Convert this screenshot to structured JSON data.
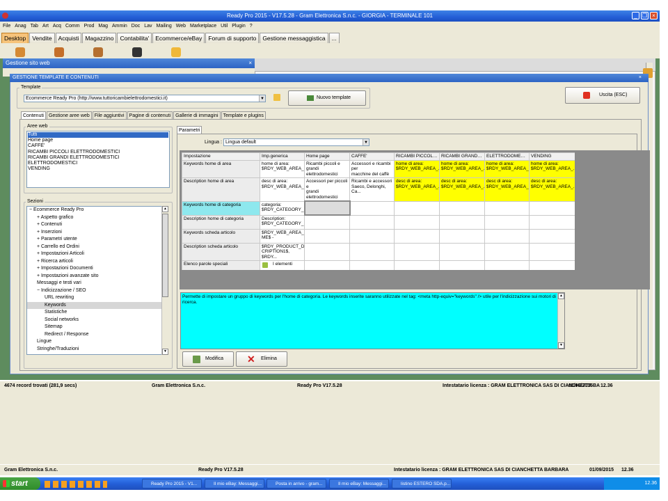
{
  "window": {
    "title": "Ready Pro 2015 - V17.5.28 - Gram Elettronica S.n.c. - GIORGIA - TERMINALE 101"
  },
  "menubar": [
    "File",
    "Anag",
    "Tab",
    "Art",
    "Acq",
    "Comm",
    "Prod",
    "Mag",
    "Ammin",
    "Doc",
    "Lav",
    "Mailing",
    "Web",
    "Marketplace",
    "Util",
    "Plugin",
    "?"
  ],
  "tabs": [
    "Desktop",
    "Vendite",
    "Acquisti",
    "Magazzino",
    "Contabilita'",
    "Ecommerce/eBay",
    "Forum di supporto",
    "Gestione messaggistica",
    "..."
  ],
  "subwindow": {
    "title": "Gestione sito web"
  },
  "main_window": {
    "title": "GESTIONE TEMPLATE E CONTENUTI",
    "template_label": "Template",
    "template_value": "Ecommerce Ready Pro (http://www.tuttoricambielettrodomestici.it)",
    "nuovo_template": "Nuovo template",
    "uscita": "Uscita (ESC)",
    "tabs": [
      "Contenuti",
      "Gestione aree web",
      "File aggiuntivi",
      "Pagine di contenuti",
      "Gallerie di immagini",
      "Template e plugins"
    ],
    "aree_web_label": "Aree web",
    "aree_web": [
      "Tutti",
      "Home page",
      "CAFFE'",
      "RICAMBI PICCOLI ELETTRODOMESTICI",
      "RICAMBI GRANDI ELETTRODOMESTICI",
      "ELETTRODOMESTICI",
      "VENDING"
    ],
    "sezioni_label": "Sezioni",
    "sezioni": [
      {
        "text": "− Ecommerce Ready Pro",
        "level": 0
      },
      {
        "text": "+ Aspetto grafico",
        "level": 1
      },
      {
        "text": "+ Contenuti",
        "level": 1
      },
      {
        "text": "+ Inserzioni",
        "level": 1
      },
      {
        "text": "+ Parametri utente",
        "level": 1
      },
      {
        "text": "+ Carrello ed Ordini",
        "level": 1
      },
      {
        "text": "+ Impostazioni Articoli",
        "level": 1
      },
      {
        "text": "+ Ricerca articoli",
        "level": 1
      },
      {
        "text": "+ Impostazioni Documenti",
        "level": 1
      },
      {
        "text": "+ Impostazioni avanzate sito",
        "level": 1
      },
      {
        "text": "Messaggi e testi vari",
        "level": 1
      },
      {
        "text": "− Indicizzazione / SEO",
        "level": 1
      },
      {
        "text": "URL rewriting",
        "level": 2
      },
      {
        "text": "Keywords",
        "level": 2
      },
      {
        "text": "Statistiche",
        "level": 2
      },
      {
        "text": "Social networks",
        "level": 2
      },
      {
        "text": "Sitemap",
        "level": 2
      },
      {
        "text": "Redirect / Response",
        "level": 2
      },
      {
        "text": "Lingue",
        "level": 1
      },
      {
        "text": "Stringhe/Traduzioni",
        "level": 1
      }
    ],
    "parametri_tab": "Parametri",
    "lingua_label": "Lingua :",
    "lingua_value": "Lingua default",
    "grid_headers": [
      "Impostazione",
      "Imp.generica",
      "Home page",
      "CAFFE'",
      "RICAMBI PICCOLI E...",
      "RICAMBI GRANDI E...",
      "ELETTRODOMESTICI",
      "VENDING"
    ],
    "grid_rows": [
      [
        "Keywords home di area",
        "home di area:\n$RDY_WEB_AREA_...",
        "Ricambi piccoli e grandi\nelettrodomestici",
        "Accessori e ricambi per\nmacchine del caffè",
        "home di area:\n$RDY_WEB_AREA_...",
        "home di area:\n$RDY_WEB_AREA_...",
        "home di area:\n$RDY_WEB_AREA_...",
        "home di area:\n$RDY_WEB_AREA_..."
      ],
      [
        "Description home di area",
        "desc di area:\n$RDY_WEB_AREA_...",
        "Accessori per piccoli e\ngrandi elettrodomestici",
        "Ricambi e accessori\nSaeco, Delonghi, Ca...",
        "desc di area:\n$RDY_WEB_AREA_...",
        "desc di area:\n$RDY_WEB_AREA_...",
        "desc di area:\n$RDY_WEB_AREA_...",
        "desc di area:\n$RDY_WEB_AREA_..."
      ],
      [
        "Keywords home di categoria",
        "categoria:\n$RDY_CATEGORY_...",
        "",
        "",
        "",
        "",
        "",
        ""
      ],
      [
        "Description home di categoria",
        "Description:\n$RDY_CATEGORY_...",
        "",
        "",
        "",
        "",
        "",
        ""
      ],
      [
        "Keywords scheda articolo",
        "$RDY_WEB_AREA_NA\nME$ -",
        "",
        "",
        "",
        "",
        "",
        ""
      ],
      [
        "Description scheda articolo",
        "$RDY_PRODUCT_DES\nCRIPTION1$, $RDY...",
        "",
        "",
        "",
        "",
        "",
        ""
      ],
      [
        "Elenco parole speciali",
        "I elementi",
        "",
        "",
        "",
        "",
        "",
        ""
      ]
    ],
    "description": "Permette di impostare un gruppo di keywords per l'home di categoria. Le keywords inserite saranno utilizzate nel tag: <meta http-equiv=\"keywords\" /> utile per l'indicizzazione sui motori di ricerca.",
    "modifica": "Modifica",
    "elimina": "Elimina"
  },
  "status_inner": {
    "records": "4674 record trovati (281,9 secs)",
    "company": "Gram Elettronica S.n.c.",
    "version": "Ready Pro V17.5.28",
    "license": "Intestatario licenza : GRAM ELETTRONICA SAS DI CIANCHETTA BA",
    "date": "01/09/2015",
    "time": "12.36"
  },
  "status_outer": {
    "company": "Gram Elettronica S.n.c.",
    "version": "Ready Pro V17.5.28",
    "license": "Intestatario licenza : GRAM ELETTRONICA SAS DI CIANCHETTA BARBARA",
    "date": "01/09/2015",
    "time": "12.36"
  },
  "taskbar": {
    "start": "start",
    "items": [
      "Ready Pro 2015 - V1...",
      "Il mio eBay: Messaggi...",
      "Posta in arrivo - gram...",
      "Il mio eBay: Messaggi...",
      "listino ESTERO SDA.p..."
    ],
    "clock": "12.36"
  },
  "colors": {
    "accent": "#245ed6",
    "highlight": "#ffff00",
    "selected": "#00ffff"
  }
}
